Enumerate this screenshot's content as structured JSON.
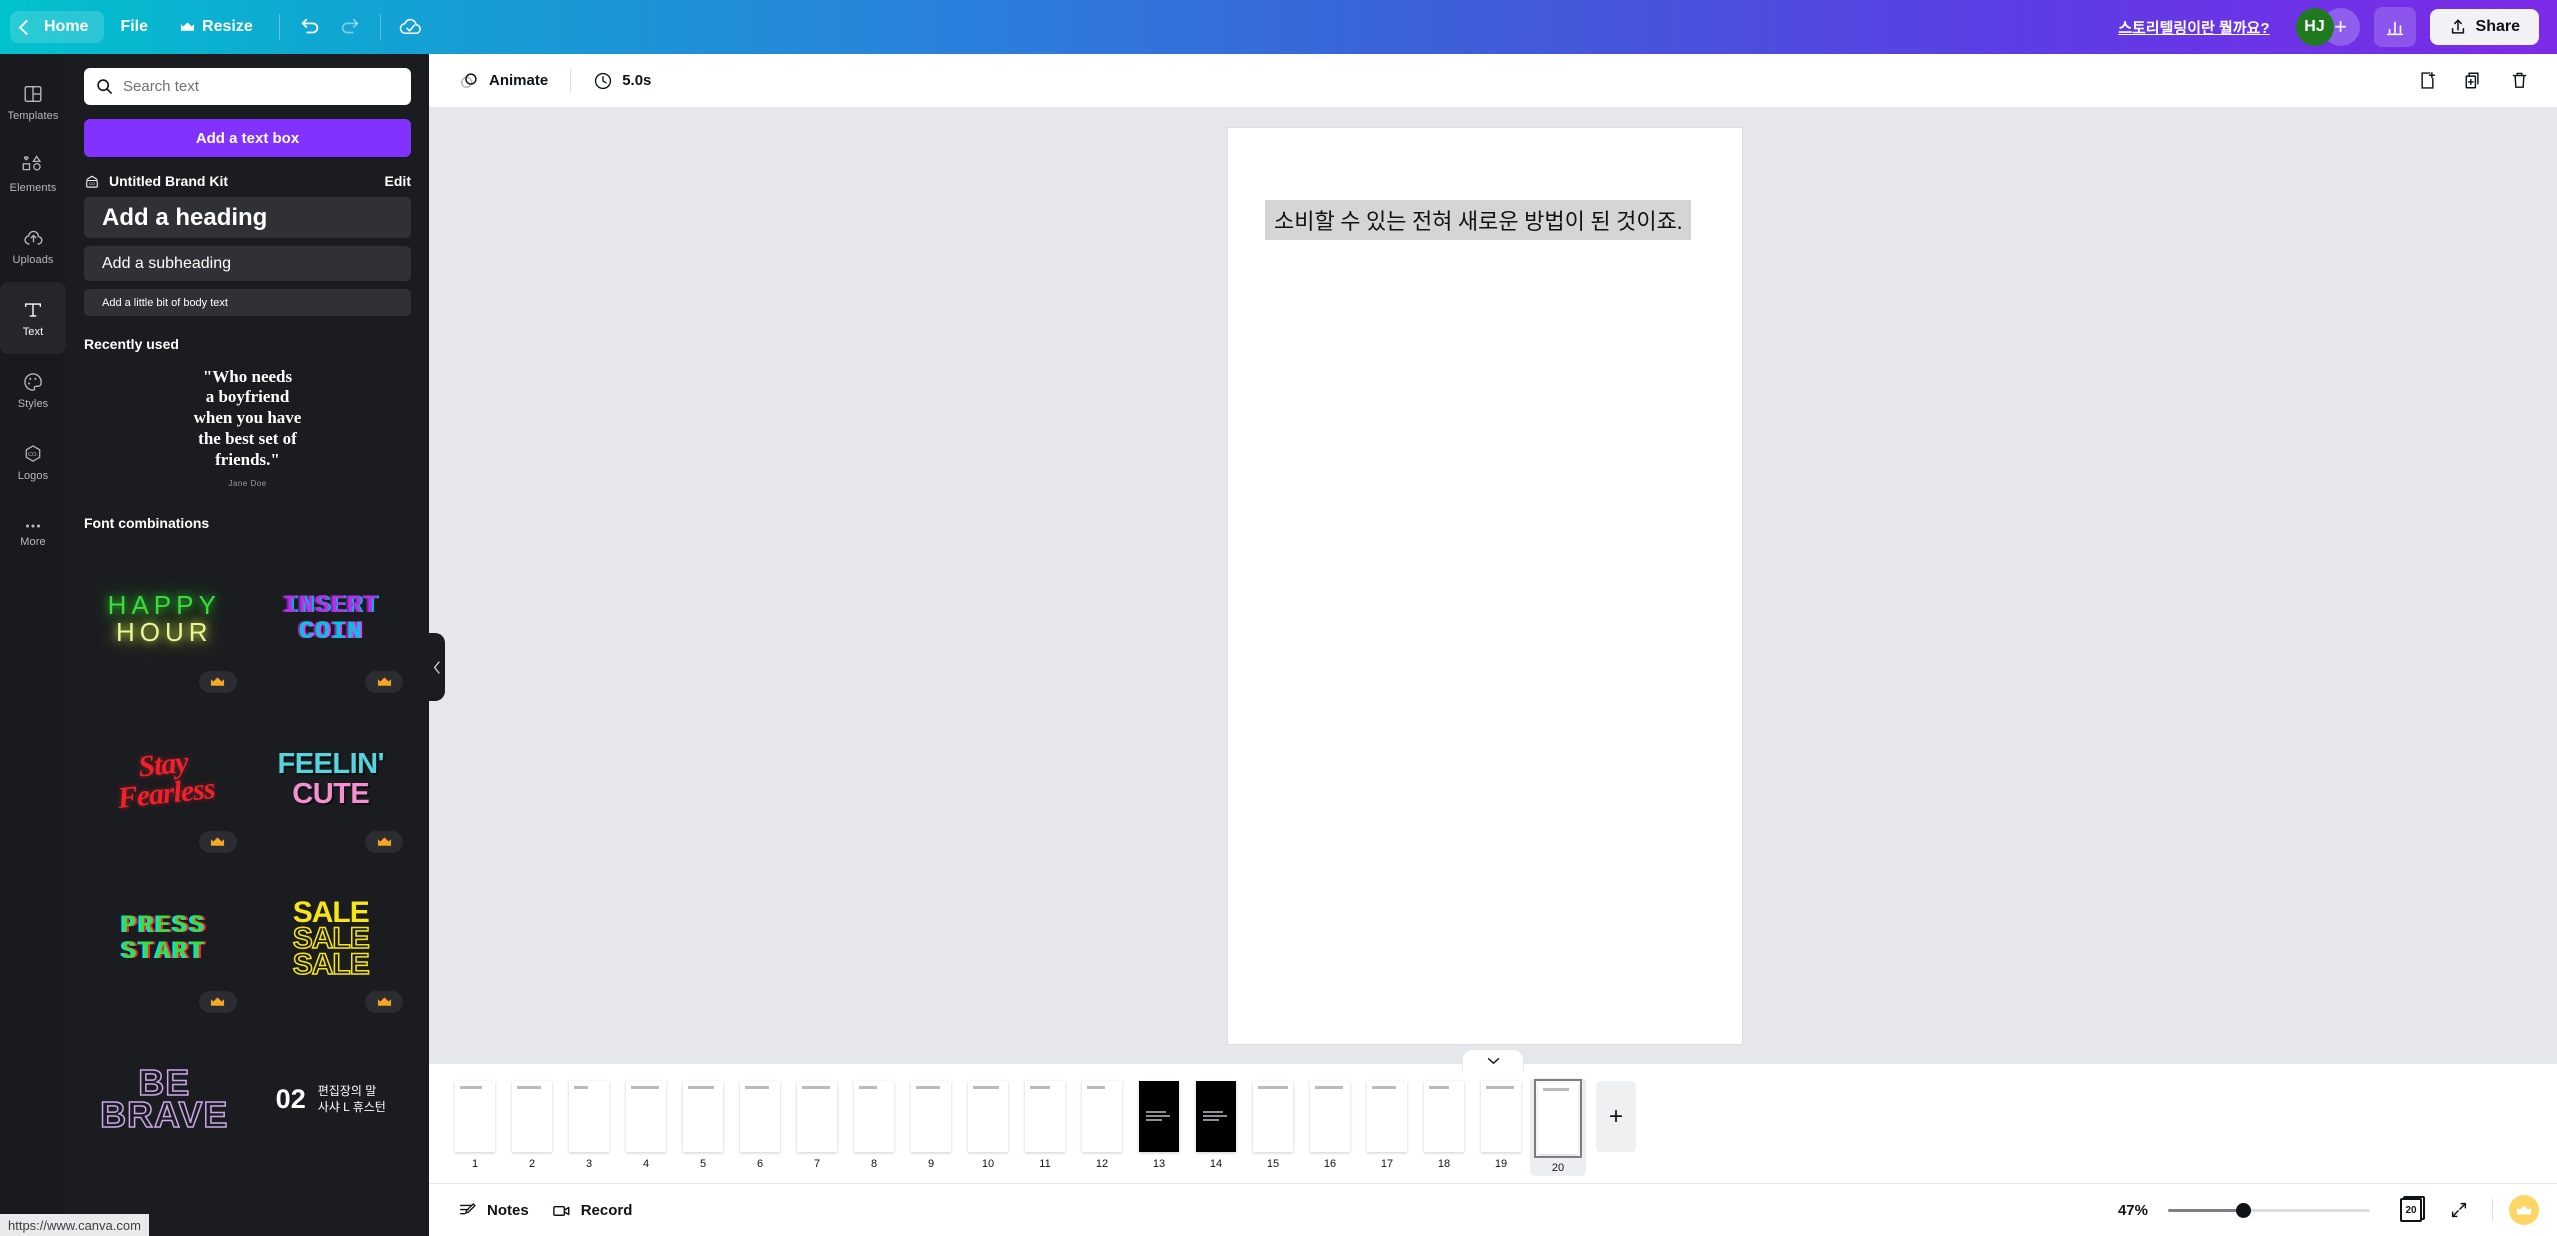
{
  "topbar": {
    "home_label": "Home",
    "file_label": "File",
    "resize_label": "Resize",
    "undo_icon": "undo-icon",
    "redo_icon": "redo-icon",
    "saved_icon": "cloud-saved-icon",
    "promo_link": "스토리텔링이란 뭘까요?",
    "avatar_initials": "HJ",
    "add_collaborator_label": "+",
    "insights_icon": "insights-bar-chart-icon",
    "share_label": "Share",
    "gradient_start": "#00c3cc",
    "gradient_mid": "#3b62d8",
    "gradient_end": "#7d2ae8"
  },
  "rail": {
    "items": [
      {
        "label": "Templates",
        "icon": "templates-icon",
        "active": false
      },
      {
        "label": "Elements",
        "icon": "elements-icon",
        "active": false
      },
      {
        "label": "Uploads",
        "icon": "uploads-cloud-icon",
        "active": false
      },
      {
        "label": "Text",
        "icon": "text-t-icon",
        "active": true
      },
      {
        "label": "Styles",
        "icon": "styles-palette-icon",
        "active": false
      },
      {
        "label": "Logos",
        "icon": "logos-hexagon-icon",
        "active": false
      },
      {
        "label": "More",
        "icon": "more-dots-icon",
        "active": false
      }
    ]
  },
  "panel": {
    "search_placeholder": "Search text",
    "search_value": "",
    "search_icon": "search-icon",
    "add_text_box_label": "Add a text box",
    "brandkit_label": "Untitled Brand Kit",
    "brandkit_icon": "brand-kit-icon",
    "brandkit_edit_label": "Edit",
    "text_styles": [
      {
        "label": "Add a heading",
        "size": "h1"
      },
      {
        "label": "Add a subheading",
        "size": "h2"
      },
      {
        "label": "Add a little bit of body text",
        "size": "body"
      }
    ],
    "recently_used_title": "Recently used",
    "recent_item": {
      "quote_lines": [
        "\"Who needs",
        "a boyfriend",
        "when you have",
        "the best set of",
        "friends.\""
      ],
      "author": "Jane Doe"
    },
    "font_combinations_title": "Font combinations",
    "font_combinations": [
      {
        "name": "happy-hour",
        "lines": [
          "HAPPY",
          "HOUR"
        ],
        "pro": true
      },
      {
        "name": "insert-coin",
        "lines": [
          "INSERT",
          "COIN"
        ],
        "pro": true
      },
      {
        "name": "stay-fearless",
        "lines": [
          "Stay",
          "Fearless"
        ],
        "pro": true
      },
      {
        "name": "feelin-cute",
        "lines": [
          "FEELIN'",
          "CUTE"
        ],
        "pro": true
      },
      {
        "name": "press-start",
        "lines": [
          "PRESS",
          "START"
        ],
        "pro": true
      },
      {
        "name": "sale",
        "lines": [
          "SALE",
          "SALE",
          "SALE"
        ],
        "pro": true
      },
      {
        "name": "be-brave",
        "lines": [
          "BE",
          "BRAVE"
        ],
        "pro": false
      },
      {
        "name": "korean-editor",
        "number": "02",
        "lines": [
          "편집장의 말",
          "사샤 L 휴스턴"
        ],
        "pro": false
      }
    ],
    "collapse_icon": "chevron-left-icon"
  },
  "canvas_toolbar": {
    "animate_label": "Animate",
    "animate_icon": "animate-icon",
    "duration_label": "5.0s",
    "timer_icon": "clock-icon",
    "add_page_icon": "add-page-icon",
    "duplicate_icon": "duplicate-page-icon",
    "delete_icon": "trash-icon"
  },
  "canvas": {
    "page_text": "소비할 수 있는 전혀 새로운 방법이 된 것이죠.",
    "comment_icon": "add-comment-icon"
  },
  "strip": {
    "collapse_icon": "chevron-down-icon",
    "add_page_label": "+",
    "pages": [
      {
        "num": "1",
        "dark": false,
        "selected": false
      },
      {
        "num": "2",
        "dark": false,
        "selected": false
      },
      {
        "num": "3",
        "dark": false,
        "selected": false
      },
      {
        "num": "4",
        "dark": false,
        "selected": false
      },
      {
        "num": "5",
        "dark": false,
        "selected": false
      },
      {
        "num": "6",
        "dark": false,
        "selected": false
      },
      {
        "num": "7",
        "dark": false,
        "selected": false
      },
      {
        "num": "8",
        "dark": false,
        "selected": false
      },
      {
        "num": "9",
        "dark": false,
        "selected": false
      },
      {
        "num": "10",
        "dark": false,
        "selected": false
      },
      {
        "num": "11",
        "dark": false,
        "selected": false
      },
      {
        "num": "12",
        "dark": false,
        "selected": false
      },
      {
        "num": "13",
        "dark": true,
        "selected": false
      },
      {
        "num": "14",
        "dark": true,
        "selected": false
      },
      {
        "num": "15",
        "dark": false,
        "selected": false
      },
      {
        "num": "16",
        "dark": false,
        "selected": false
      },
      {
        "num": "17",
        "dark": false,
        "selected": false
      },
      {
        "num": "18",
        "dark": false,
        "selected": false
      },
      {
        "num": "19",
        "dark": false,
        "selected": false
      },
      {
        "num": "20",
        "dark": false,
        "selected": true
      }
    ]
  },
  "bottombar": {
    "notes_label": "Notes",
    "notes_icon": "notes-icon",
    "record_label": "Record",
    "record_icon": "record-camera-icon",
    "zoom_level": "47%",
    "page_count": "20",
    "page_count_icon": "page-count-icon",
    "expand_icon": "fullscreen-expand-icon",
    "crown_icon": "crown-icon"
  },
  "status": {
    "url": "https://www.canva.com"
  }
}
